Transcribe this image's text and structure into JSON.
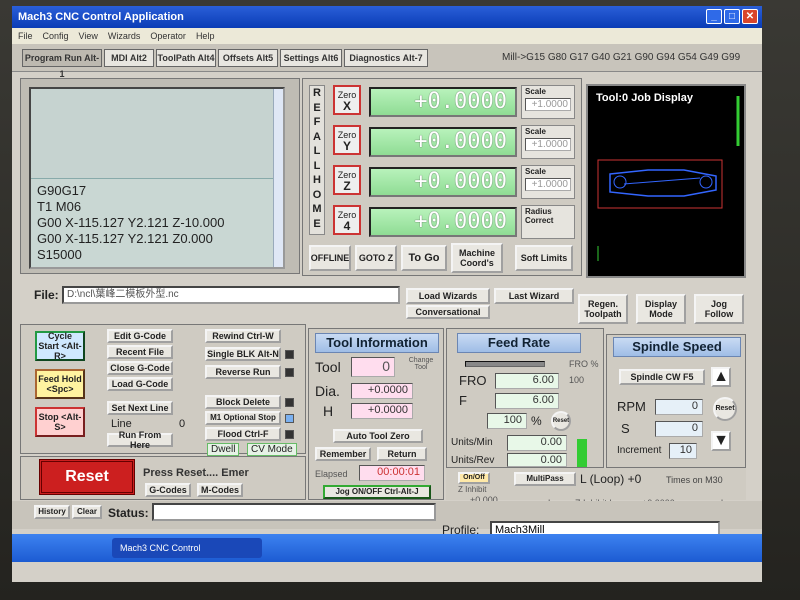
{
  "window": {
    "title": "Mach3 CNC Control Application",
    "min": "_",
    "max": "□",
    "close": "✕"
  },
  "menu": [
    "File",
    "Config",
    "View",
    "Wizards",
    "Operator",
    "Help"
  ],
  "tabs": [
    "Program Run Alt-1",
    "MDI Alt2",
    "ToolPath Alt4",
    "Offsets Alt5",
    "Settings Alt6",
    "Diagnostics Alt-7"
  ],
  "active_gcodes": "Mill->G15  G80 G17 G40 G21 G90 G94 G54 G49 G99",
  "gcode_listing": {
    "lines": [
      "G90G17",
      "T1 M06",
      "G00 X-115.127 Y2.121 Z-10.000",
      "G00 X-115.127 Y2.121 Z0.000",
      "S15000"
    ]
  },
  "ref_all_home": [
    "R",
    "E",
    "F",
    "A",
    "L",
    "L",
    "H",
    "O",
    "M",
    "E"
  ],
  "axes": [
    {
      "zero": "Zero",
      "axis": "X",
      "value": "+0.0000",
      "scale_label": "Scale",
      "scale": "+1.0000"
    },
    {
      "zero": "Zero",
      "axis": "Y",
      "value": "+0.0000",
      "scale_label": "Scale",
      "scale": "+1.0000"
    },
    {
      "zero": "Zero",
      "axis": "Z",
      "value": "+0.0000",
      "scale_label": "Scale",
      "scale": "+1.0000"
    },
    {
      "zero": "Zero",
      "axis": "4",
      "value": "+0.0000",
      "radius": "Radius Correct"
    }
  ],
  "dro_buttons": [
    "OFFLINE",
    "GOTO Z",
    "To Go",
    "Machine Coord's",
    "Soft Limits"
  ],
  "job_display": {
    "title": "Tool:0   Job Display"
  },
  "display_buttons": [
    "Regen. Toolpath",
    "Display Mode",
    "Jog Follow"
  ],
  "file": {
    "label": "File:",
    "path": "D:\\ncl\\葉峰二模板外型.nc"
  },
  "wizards": [
    "Load Wizards",
    "Last Wizard",
    "Conversational"
  ],
  "program_buttons": {
    "cycle_start": "Cycle Start <Alt-R>",
    "feed_hold": "Feed Hold <Spc>",
    "stop": "Stop <Alt-S>",
    "edit": "Edit G-Code",
    "recent": "Recent File",
    "close": "Close G-Code",
    "load": "Load G-Code",
    "set_next": "Set Next Line",
    "line_label": "Line",
    "line_value": "0",
    "run_from_here": "Run From Here",
    "rewind": "Rewind Ctrl-W",
    "single_blk": "Single BLK Alt-N",
    "reverse_run": "Reverse Run",
    "block_delete": "Block Delete",
    "m1_optional": "M1 Optional Stop",
    "flood": "Flood Ctrl-F",
    "dwell": "Dwell",
    "cv_mode": "CV Mode"
  },
  "reset": {
    "label": "Reset",
    "hint": "Press Reset.... Emer",
    "gcodes": "G-Codes",
    "mcodes": "M-Codes"
  },
  "tool_info": {
    "title": "Tool Information",
    "tool_label": "Tool",
    "tool_value": "0",
    "change_label": "Change Tool",
    "dia_label": "Dia.",
    "dia_value": "+0.0000",
    "h_label": "H",
    "h_value": "+0.0000",
    "auto_zero": "Auto Tool Zero",
    "remember": "Remember",
    "return": "Return",
    "elapsed_label": "Elapsed",
    "elapsed": "00:00:01",
    "jog": "Jog ON/OFF Ctrl-Alt-J"
  },
  "feed_rate": {
    "title": "Feed Rate",
    "fro_pct_label": "FRO %",
    "fro_pct": "100",
    "fro_label": "FRO",
    "fro": "6.00",
    "f_label": "F",
    "f": "6.00",
    "pct": "100",
    "pct_sign": "%",
    "reset": "Reset",
    "upm_label": "Units/Min",
    "upm": "0.00",
    "upr_label": "Units/Rev",
    "upr": "0.00"
  },
  "spindle": {
    "title": "Spindle Speed",
    "cw": "Spindle CW F5",
    "rpm_label": "RPM",
    "rpm": "0",
    "s_label": "S",
    "s": "0",
    "inc_label": "Increment",
    "inc": "10",
    "reset": "Reset"
  },
  "bottom_mid": {
    "onoff": "On/Off",
    "zinhibit": "Z Inhibit",
    "zval": "+0.000",
    "multipass": "MultiPass",
    "loop": "L (Loop) +0",
    "times": "Times on M30",
    "lower": "Lower Z Inhibit by",
    "lower_val": "+0.0000",
    "each_pass": "on each pass"
  },
  "status": {
    "history": "History",
    "clear": "Clear",
    "status_label": "Status:",
    "profile_label": "Profile:",
    "profile": "Mach3Mill"
  },
  "taskbar": {
    "item": "Mach3 CNC Control"
  },
  "colors": {
    "dro_green": "#9fe6a3",
    "reset_red": "#cc1f1f",
    "title_blue": "#0a3cb6"
  }
}
